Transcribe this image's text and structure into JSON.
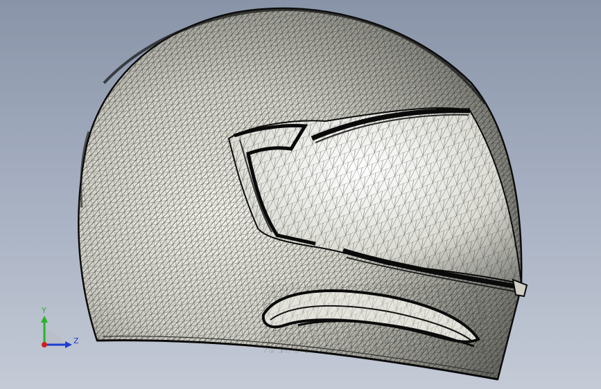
{
  "view": {
    "model": "motorcycle-helmet",
    "display_mode": "wireframe-shaded",
    "background_top": "#8994a8",
    "background_bottom": "#c4cad6"
  },
  "triad": {
    "y_label": "Y",
    "z_label": "Z",
    "y_color": "#27b427",
    "z_color": "#1f3fd0",
    "origin_color": "#d02020"
  }
}
